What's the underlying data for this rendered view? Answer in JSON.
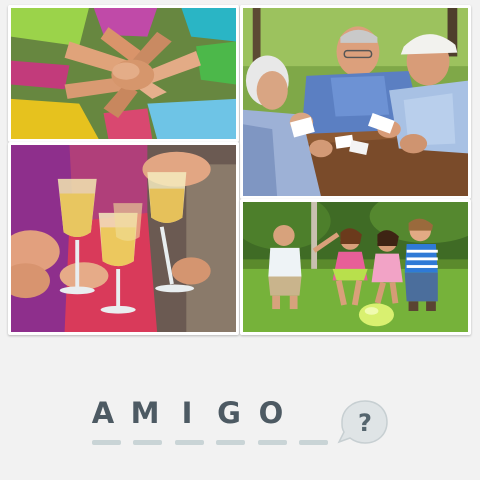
{
  "puzzle": {
    "answer_letters": [
      "A",
      "M",
      "I",
      "G",
      "O",
      ""
    ],
    "slot_count": 6,
    "hint_symbol": "?"
  },
  "colors": {
    "background": "#f2f2f2",
    "letter": "#4d5a63",
    "slot_line": "#c9d4d6",
    "hint_bubble": "#dfe4e6",
    "hint_mark": "#55656e"
  },
  "photos": [
    {
      "subject": "hands-stacked-together-icon"
    },
    {
      "subject": "elderly-men-playing-cards-icon"
    },
    {
      "subject": "champagne-toast-icon"
    },
    {
      "subject": "children-playing-in-park-icon"
    }
  ]
}
